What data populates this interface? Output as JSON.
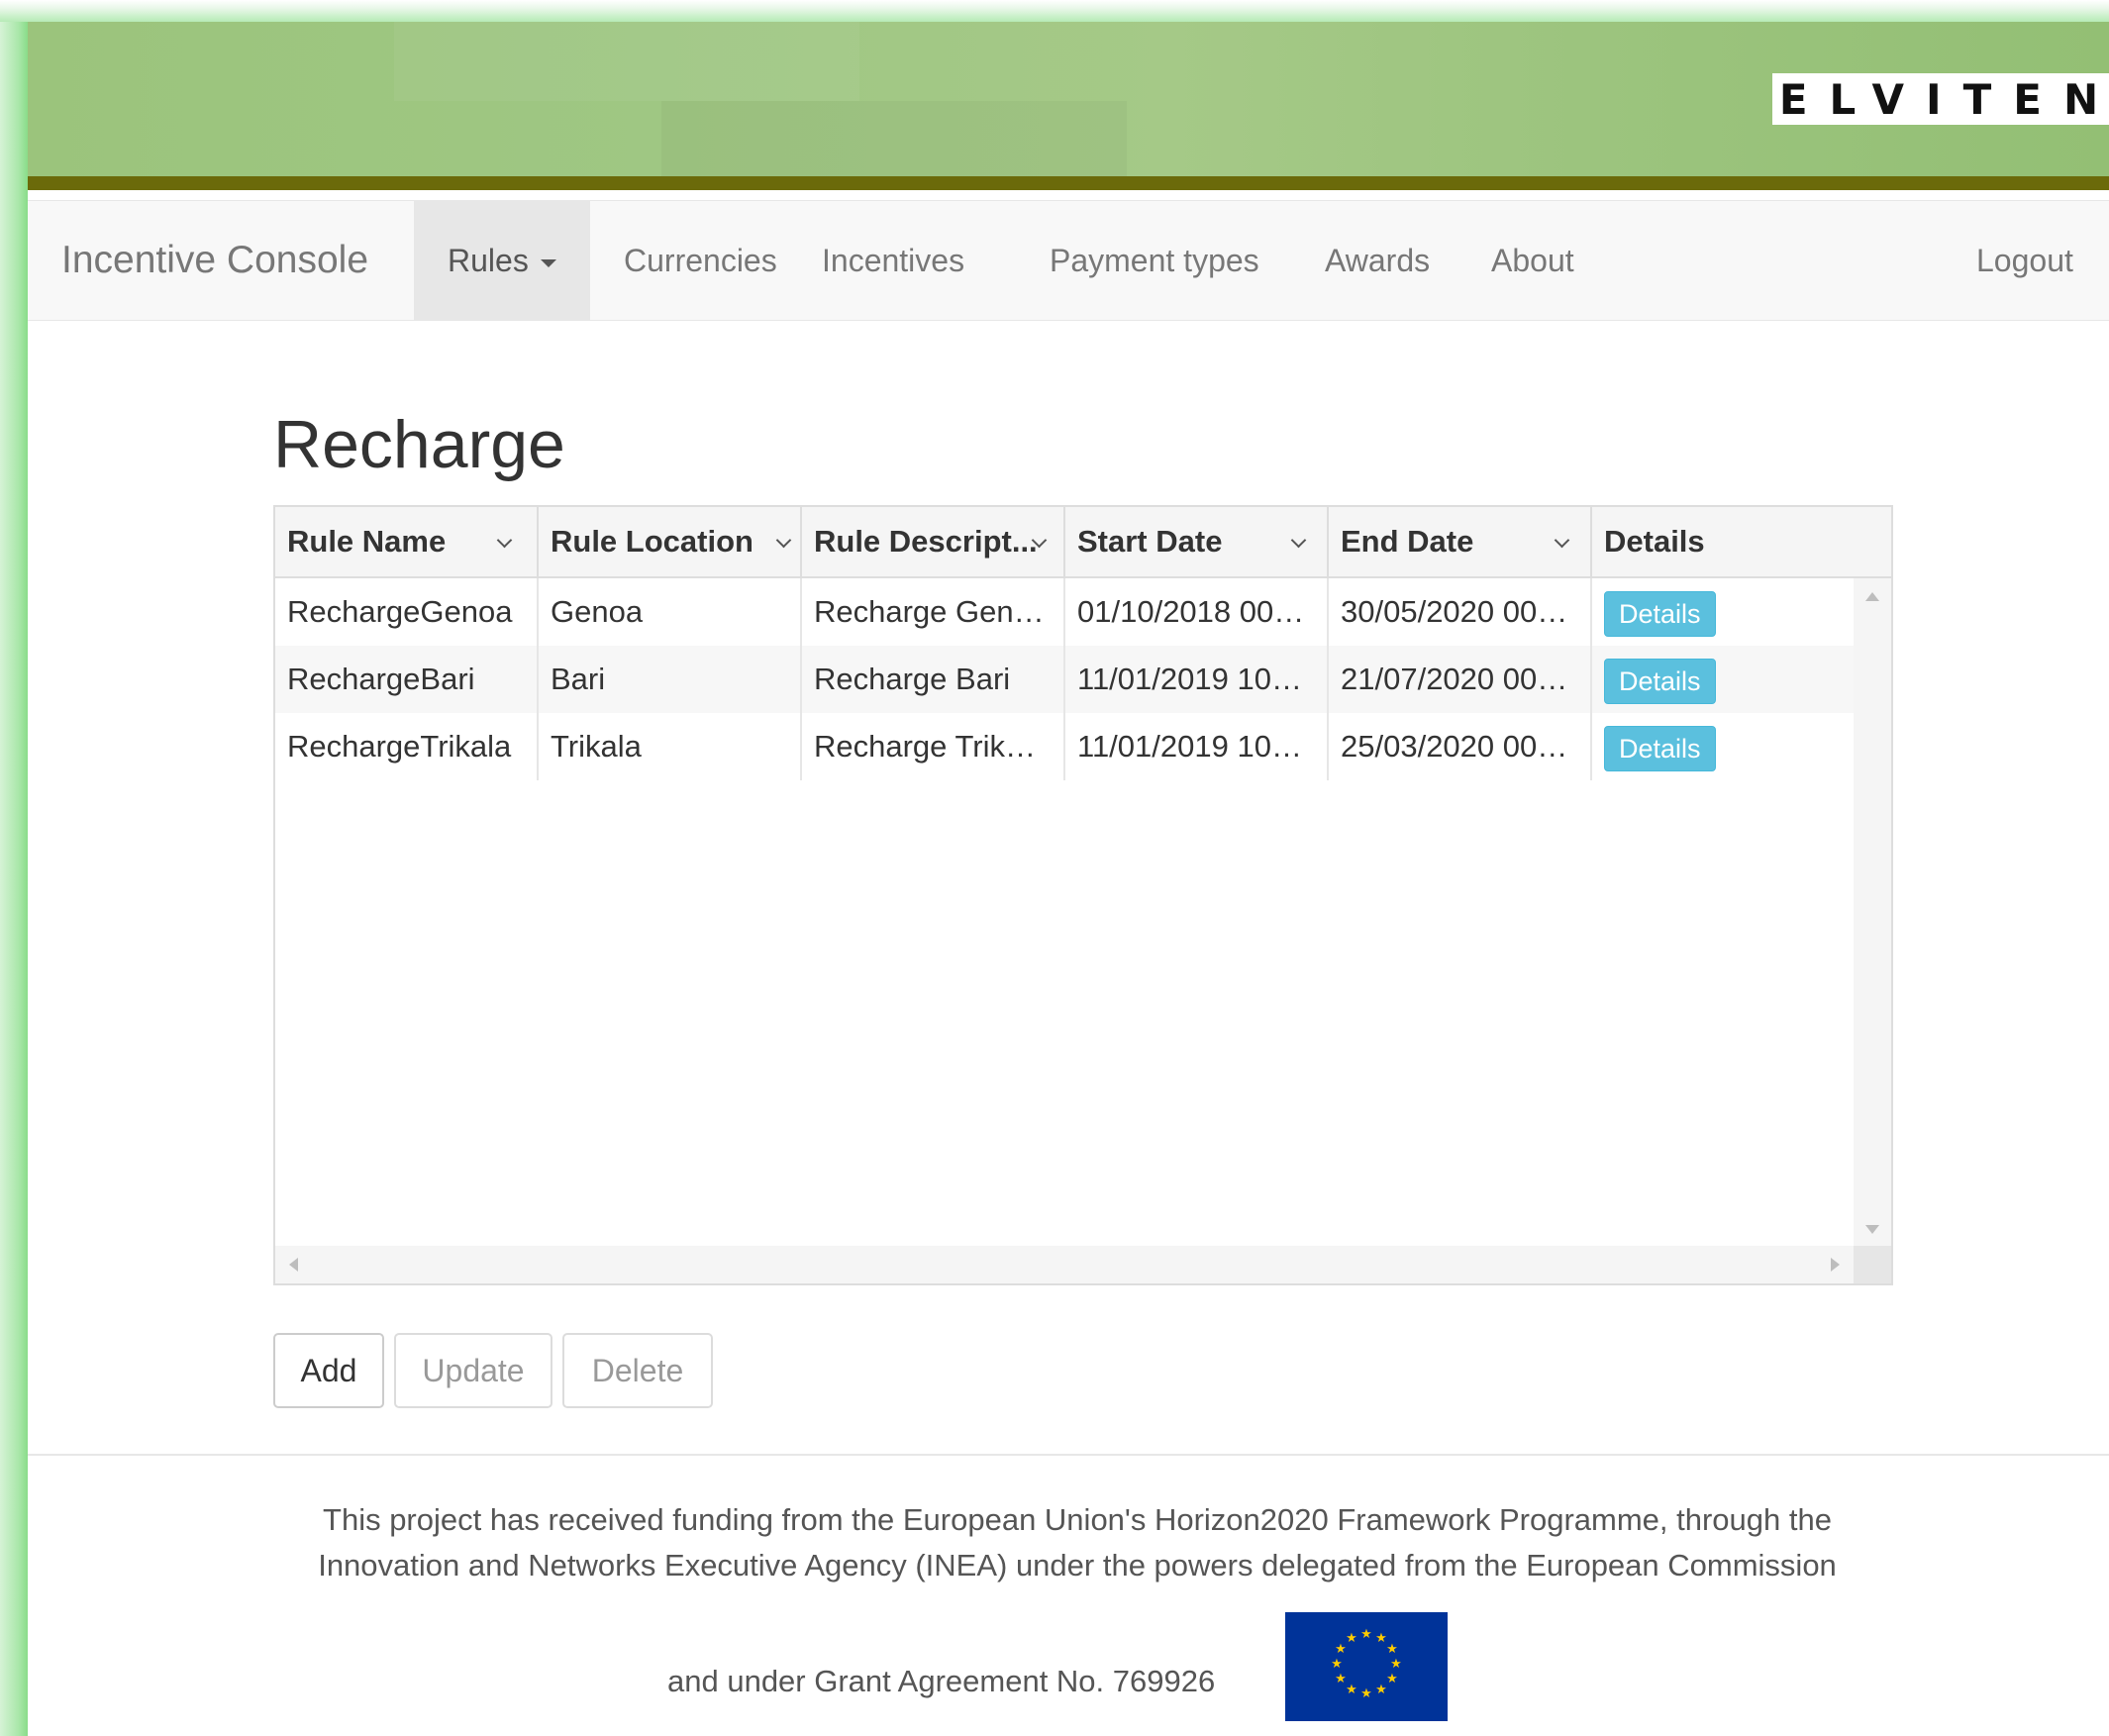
{
  "header": {
    "logo_text": "ELVITEN"
  },
  "navbar": {
    "brand": "Incentive Console",
    "items": [
      {
        "label": "Rules",
        "active": true,
        "dropdown": true
      },
      {
        "label": "Currencies"
      },
      {
        "label": "Incentives"
      },
      {
        "label": "Payment types"
      },
      {
        "label": "Awards"
      },
      {
        "label": "About"
      }
    ],
    "logout": "Logout"
  },
  "page": {
    "title": "Recharge"
  },
  "grid": {
    "columns": [
      {
        "label": "Rule Name",
        "sortable": true
      },
      {
        "label": "Rule Location",
        "sortable": true
      },
      {
        "label": "Rule Descript...",
        "sortable": true
      },
      {
        "label": "Start Date",
        "sortable": true
      },
      {
        "label": "End Date",
        "sortable": true
      },
      {
        "label": "Details",
        "sortable": false
      }
    ],
    "rows": [
      {
        "name": "RechargeGenoa",
        "location": "Genoa",
        "description": "Recharge Gen…",
        "start": "01/10/2018 00…",
        "end": "30/05/2020 00…",
        "details": "Details"
      },
      {
        "name": "RechargeBari",
        "location": "Bari",
        "description": "Recharge Bari",
        "start": "11/01/2019 10…",
        "end": "21/07/2020 00…",
        "details": "Details"
      },
      {
        "name": "RechargeTrikala",
        "location": "Trikala",
        "description": "Recharge Trik…",
        "start": "11/01/2019 10…",
        "end": "25/03/2020 00…",
        "details": "Details"
      }
    ]
  },
  "actions": {
    "add": "Add",
    "update": "Update",
    "delete": "Delete"
  },
  "footer": {
    "line1": "This project has received funding from the European Union's Horizon2020 Framework Programme, through the",
    "line2": "Innovation and Networks Executive Agency (INEA) under the powers delegated from the European Commission",
    "line3": "and under Grant Agreement No. 769926"
  },
  "colors": {
    "banner": "#9fc783",
    "banner_bar": "#6b6a0a",
    "info_button": "#5bc0de",
    "eu_blue": "#003399",
    "eu_star": "#ffcc00"
  }
}
